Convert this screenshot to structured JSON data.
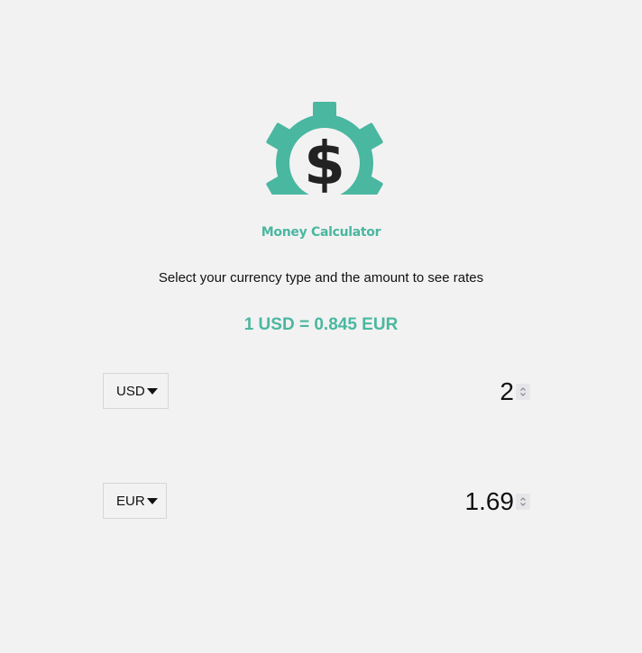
{
  "app": {
    "title": "Money Calculator",
    "logo_icon": "gear-dollar-icon"
  },
  "instructions": "Select your currency type and the amount to see rates",
  "rate": {
    "base_amount": "1",
    "base_currency": "USD",
    "equals": "=",
    "rate_value": "0.845",
    "target_currency": "EUR"
  },
  "from": {
    "currency": "USD",
    "amount": "2"
  },
  "to": {
    "currency": "EUR",
    "amount": "1.69"
  },
  "colors": {
    "accent": "#4ab7a0",
    "background": "#f2f2f2",
    "text": "#111111"
  }
}
